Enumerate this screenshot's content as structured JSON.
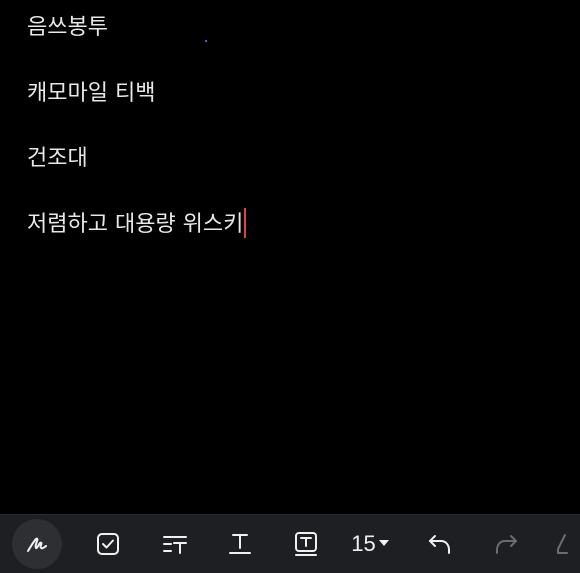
{
  "note": {
    "lines": [
      "음쓰봉투",
      "캐모마일 티백",
      "건조대",
      "저렴하고 대용량 위스키"
    ]
  },
  "toolbar": {
    "font_size": "15",
    "icons": {
      "pen": "handwriting-pen-icon",
      "checkbox": "checkbox-icon",
      "text_style": "text-style-icon",
      "underline": "underline-text-icon",
      "text_box": "text-box-icon",
      "font_size_dropdown": "caret-down-icon",
      "undo": "undo-icon",
      "redo": "redo-icon",
      "more": "pen-tool-icon"
    }
  },
  "colors": {
    "background": "#000000",
    "text": "#e8e8e8",
    "caret": "#e0414d",
    "toolbar_bg": "#1e1f22",
    "toolbar_icon": "#f0f0f0",
    "toolbar_icon_disabled": "#6b6c70"
  }
}
